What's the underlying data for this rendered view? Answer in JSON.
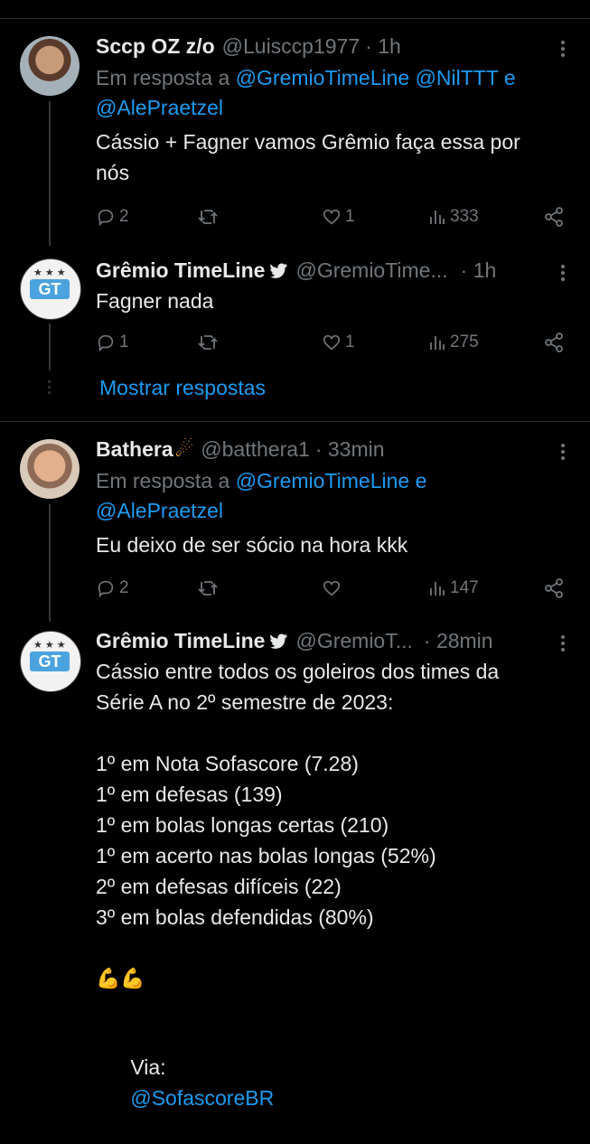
{
  "tweets": [
    {
      "name": "Sccp OZ z/o",
      "handle": "@Luisccp1977",
      "time": "· 1h",
      "reply_prefix": "Em resposta a",
      "reply_mentions_1": "@GremioTimeLine @NilTTT e",
      "reply_mentions_2": "@AlePraetzel",
      "text": "Cássio + Fagner vamos Grêmio faça essa por\nnós",
      "replies": "2",
      "retweets": "",
      "likes": "1",
      "views": "333"
    },
    {
      "name": "Grêmio TimeLine",
      "handle": "@GremioTime...",
      "time": "· 1h",
      "text": "Fagner nada",
      "replies": "1",
      "retweets": "",
      "likes": "1",
      "views": "275"
    },
    {
      "name": "Bathera",
      "name_emoji": "☄",
      "handle": "@batthera1",
      "time": "· 33min",
      "reply_prefix": "Em resposta a",
      "reply_mentions_1": "@GremioTimeLine e",
      "reply_mentions_2": "@AlePraetzel",
      "text": "Eu deixo de ser sócio na hora kkk",
      "replies": "2",
      "retweets": "",
      "likes": "",
      "views": "147"
    },
    {
      "name": "Grêmio TimeLine",
      "handle": "@GremioT...",
      "time": "· 28min",
      "text": "Cássio entre todos os goleiros dos times da\nSérie A no 2º semestre de 2023:\n\n1º em Nota Sofascore (7.28)\n1º em defesas (139)\n1º em bolas longas certas (210)\n1º em acerto nas bolas longas (52%)\n2º em defesas difíceis (22)\n3º em bolas defendidas (80%)",
      "emoji": "💪💪",
      "via_label": "Via:",
      "via_mention": "@SofascoreBR"
    }
  ],
  "show_replies_label": "Mostrar respostas",
  "icons": [
    "reply-icon",
    "retweet-icon",
    "like-icon",
    "views-icon",
    "share-icon",
    "verified-icon",
    "more-icon"
  ],
  "colors": {
    "background": "#000000",
    "link": "#1d9bf0",
    "muted": "#71767b",
    "text": "#e7e9ea"
  }
}
